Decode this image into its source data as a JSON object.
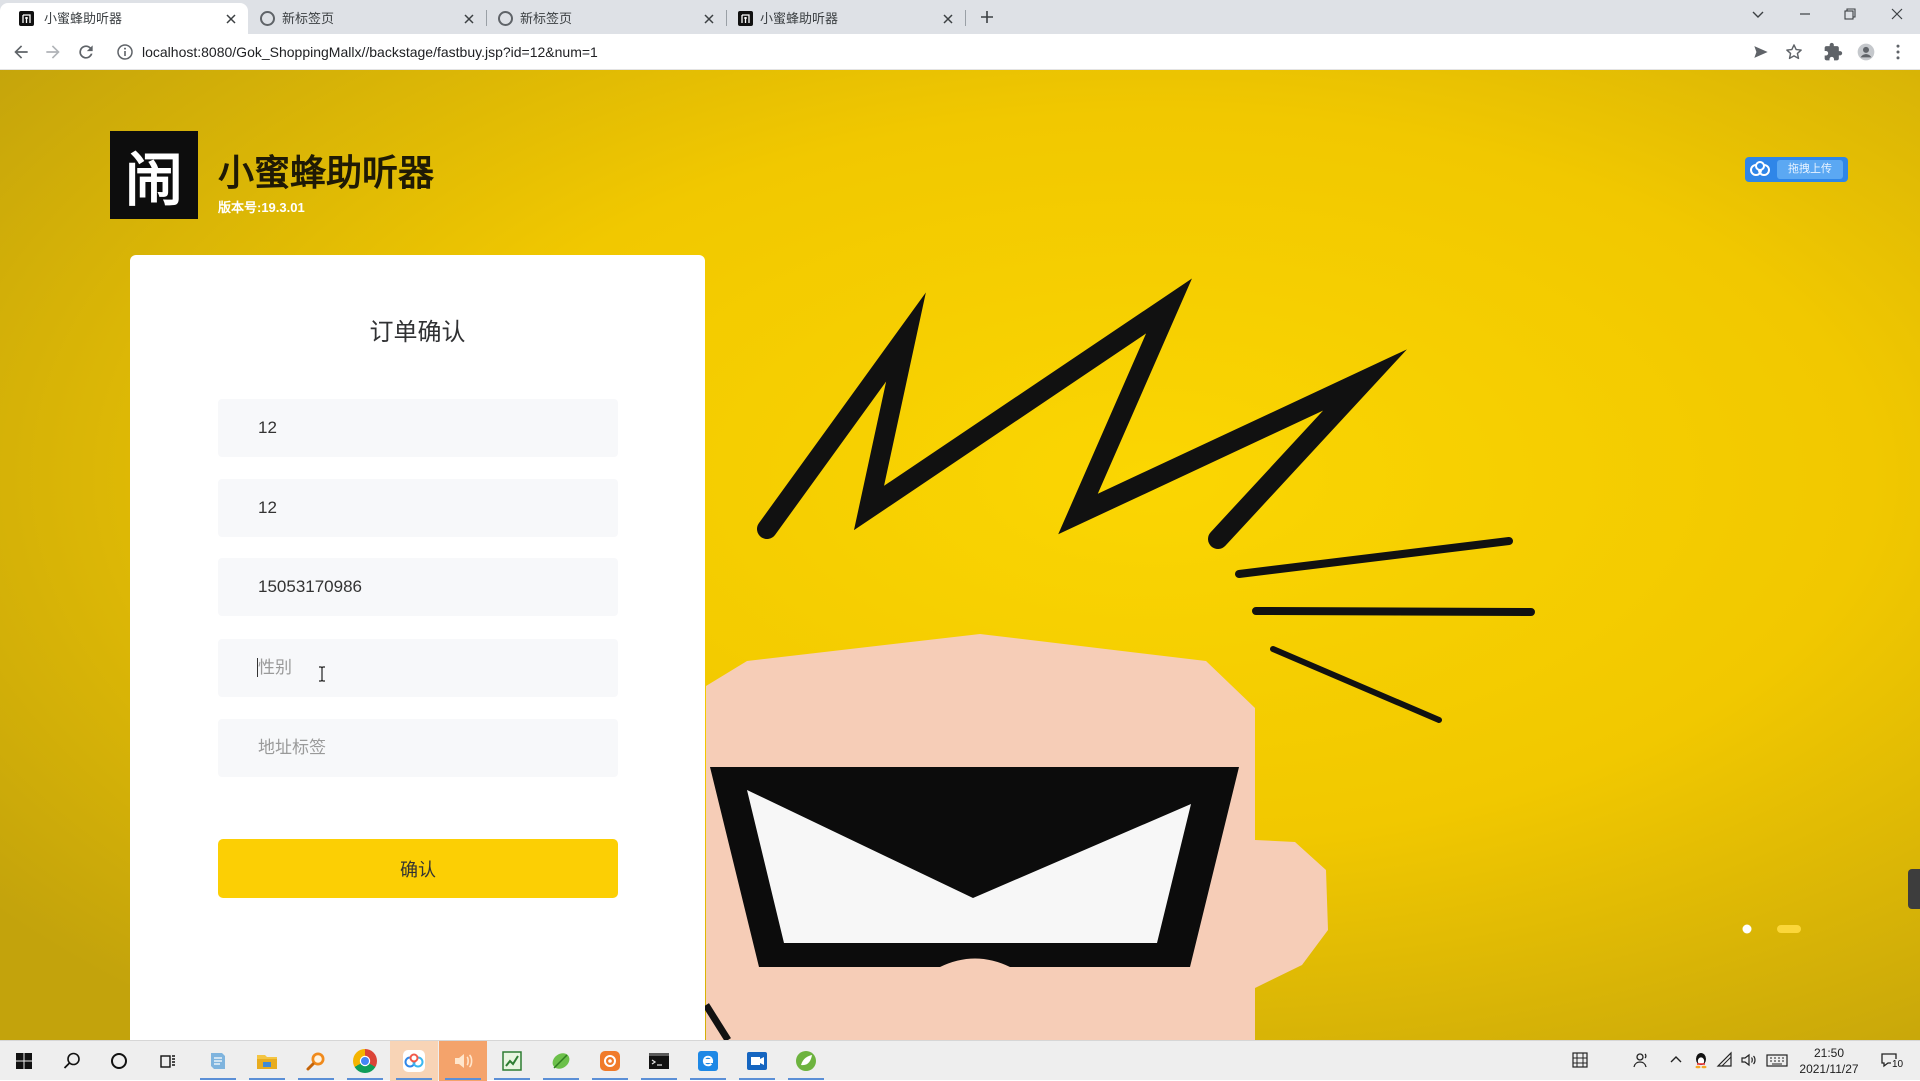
{
  "browser": {
    "tabs": [
      {
        "title": "小蜜蜂助听器",
        "favicon": "site-logo-icon",
        "active": true
      },
      {
        "title": "新标签页",
        "favicon": "globe-icon",
        "active": false
      },
      {
        "title": "新标签页",
        "favicon": "globe-icon",
        "active": false
      },
      {
        "title": "小蜜蜂助听器",
        "favicon": "site-logo-icon",
        "active": false
      }
    ],
    "address_bar": {
      "url": "localhost:8080/Gok_ShoppingMallx//backstage/fastbuy.jsp?id=12&num=1"
    },
    "toolbar_icons": [
      "back-arrow-icon",
      "forward-arrow-icon",
      "reload-icon",
      "site-info-icon",
      "send-icon",
      "bookmark-star-icon",
      "extensions-icon",
      "profile-icon",
      "menu-icon"
    ],
    "window_controls": [
      "tab-search-icon",
      "minimize-icon",
      "restore-icon",
      "close-icon"
    ]
  },
  "header": {
    "logo_glyph": "闹",
    "title": "小蜜蜂助听器",
    "version": "版本号:19.3.01"
  },
  "upload_widget": {
    "icon": "baidu-netdisk-icon",
    "label": "拖拽上传"
  },
  "order_form": {
    "title": "订单确认",
    "fields": [
      {
        "value": "12"
      },
      {
        "value": "12"
      },
      {
        "value": "15053170986"
      },
      {
        "placeholder": "性别",
        "focused": true
      },
      {
        "placeholder": "地址标签"
      }
    ],
    "submit_label": "确认"
  },
  "carousel": {
    "slide_count": 2,
    "active_index": 1
  },
  "taskbar": {
    "system_icons": [
      "windows-start-icon",
      "search-icon",
      "cortana-icon",
      "task-view-icon"
    ],
    "apps": [
      {
        "icon": "notepad-icon",
        "running": true
      },
      {
        "icon": "file-explorer-icon",
        "running": true
      },
      {
        "icon": "everything-search-icon",
        "running": true
      },
      {
        "icon": "chrome-icon",
        "running": true
      },
      {
        "icon": "baidu-netdisk-icon",
        "running": true
      },
      {
        "icon": "audio-app-icon",
        "running": true,
        "flashing": true
      },
      {
        "icon": "chart-app-icon",
        "running": true
      },
      {
        "icon": "green-leaf-app-icon",
        "running": true
      },
      {
        "icon": "orange-app-icon",
        "running": true
      },
      {
        "icon": "terminal-icon",
        "running": true
      },
      {
        "icon": "internet-explorer-icon",
        "running": true
      },
      {
        "icon": "meeting-app-icon",
        "running": true
      },
      {
        "icon": "spring-icon",
        "running": true
      }
    ],
    "tray_icons": [
      "ime-icon",
      "voice-input-icon",
      "chevron-up-icon",
      "qq-icon",
      "network-icon",
      "volume-icon",
      "keyboard-icon",
      "notification-icon"
    ],
    "clock": {
      "time": "21:50",
      "date": "2021/11/27"
    },
    "notification_count": "10"
  },
  "colors": {
    "accent_yellow": "#FCCF04",
    "background_yellow": "#F2C900",
    "upload_blue": "#2F86E8",
    "input_background": "#F7F8FA",
    "card_background": "#FFFFFF"
  }
}
